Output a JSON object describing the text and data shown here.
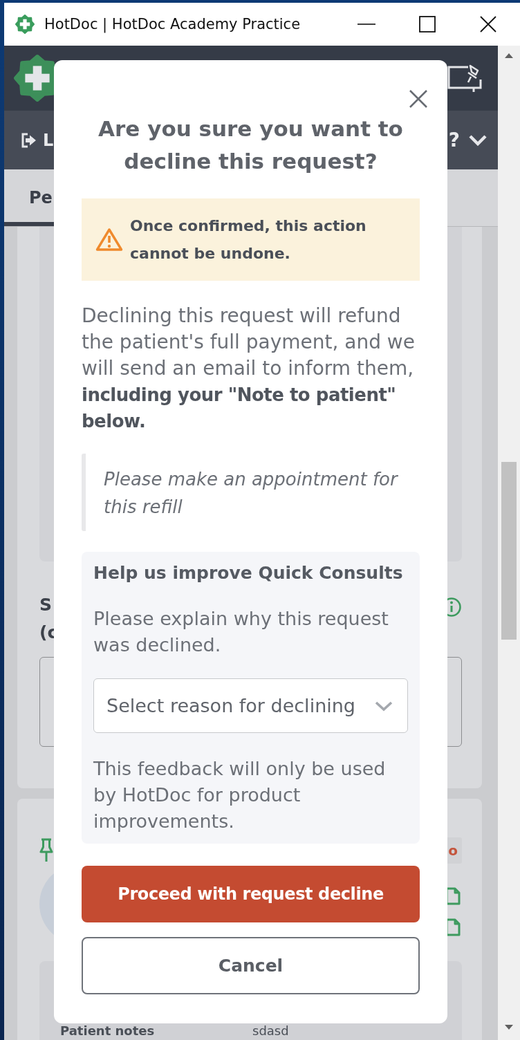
{
  "window": {
    "title": "HotDoc | HotDoc Academy Practice"
  },
  "nav_bar": {
    "left_label": "L",
    "right_label": "?"
  },
  "tabs": [
    {
      "label": "Pe",
      "selected": true
    }
  ],
  "form_card": {
    "label_lines": [
      "S",
      "(c"
    ]
  },
  "request_card": {
    "badge": "o",
    "notes_label": "Patient notes",
    "notes_value": "sdasd"
  },
  "dialog": {
    "title": "Are you sure you want to decline this request?",
    "warning": "Once confirmed, this action cannot be undone.",
    "body": "Declining this request will refund the patient's full payment, and we will send an email to inform them, **including your \"Note to patient\" below.**",
    "quote": "Please make an appointment for this refill",
    "feedback": {
      "heading": "Help us improve Quick Consults",
      "prompt": "Please explain why this request was declined.",
      "reason_select": {
        "placeholder": "Select reason for declining"
      },
      "note": "This feedback will only be used by HotDoc for product improvements."
    },
    "buttons": [
      {
        "label": "Proceed with request decline",
        "kind": "danger"
      },
      {
        "label": "Cancel",
        "kind": "secondary"
      }
    ]
  }
}
